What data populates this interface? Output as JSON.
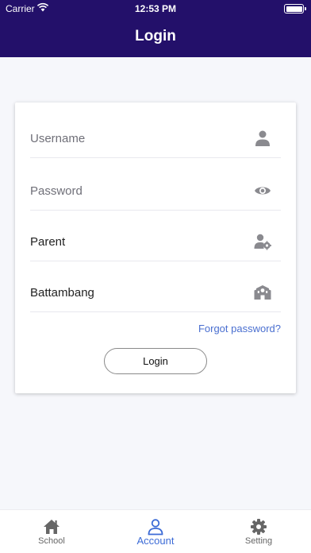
{
  "status_bar": {
    "carrier": "Carrier",
    "time": "12:53 PM"
  },
  "header": {
    "title": "Login"
  },
  "form": {
    "username": {
      "placeholder": "Username",
      "icon": "user-icon"
    },
    "password": {
      "placeholder": "Password",
      "icon": "eye-icon"
    },
    "role": {
      "value": "Parent",
      "icon": "user-gear-icon"
    },
    "school": {
      "value": "Battambang",
      "icon": "school-icon"
    },
    "forgot_label": "Forgot password?",
    "login_label": "Login"
  },
  "tabbar": {
    "items": [
      {
        "label": "School",
        "icon": "home-icon"
      },
      {
        "label": "Account",
        "icon": "user-outline-icon",
        "active": true
      },
      {
        "label": "Setting",
        "icon": "gear-icon"
      }
    ]
  },
  "colors": {
    "header": "#23106a",
    "accent": "#3c6bd6",
    "link": "#4a6fd0"
  }
}
